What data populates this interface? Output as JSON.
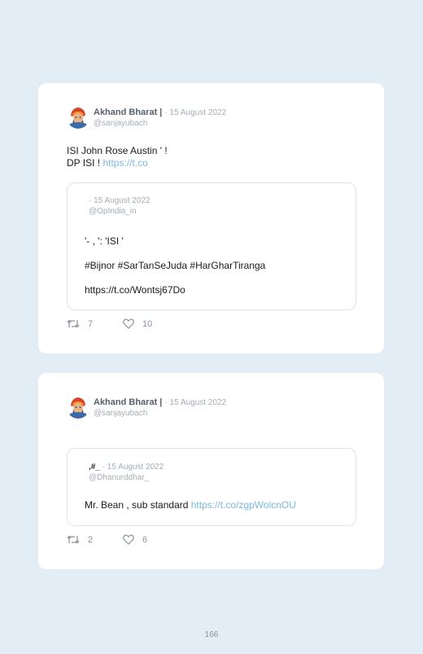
{
  "tweets": [
    {
      "author_name": "Akhand Bharat |",
      "date": "· 15 August 2022",
      "handle": "@sanjayubach",
      "text_line1": "ISI John Rose Austin ' !",
      "text_line2_prefix": "DP ISI ! ",
      "text_line2_link": "https://t.co",
      "quote": {
        "name": "",
        "date": "· 15 August 2022",
        "handle": "@OpIndia_in",
        "text": "'- , ': 'ISI '",
        "hashtags": "#Bijnor #SarTanSeJuda #HarGharTiranga",
        "link": "https://t.co/Wontsj67Do"
      },
      "retweets": "7",
      "likes": "10"
    },
    {
      "author_name": "Akhand Bharat |",
      "date": "· 15 August 2022",
      "handle": "@sanjayubach",
      "quote": {
        "name": ",#_",
        "date": "· 15 August 2022",
        "handle": "@Dhanurddhar_",
        "text_prefix": "Mr. Bean , sub standard ",
        "link": "https://t.co/zgpWolcnOU"
      },
      "retweets": "2",
      "likes": "6"
    }
  ],
  "page_number": "166",
  "colors": {
    "background": "#e2edf6",
    "card": "#ffffff",
    "link": "#7ab9df",
    "muted": "#a4adb5"
  }
}
